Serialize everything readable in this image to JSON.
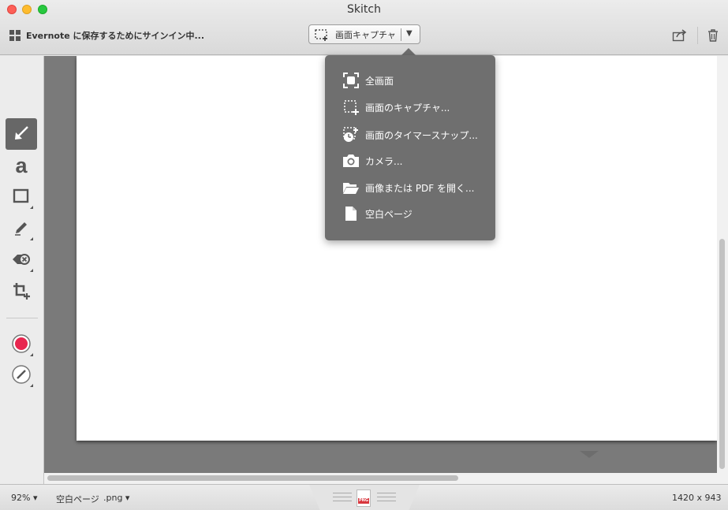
{
  "window": {
    "title": "Skitch"
  },
  "toolbar": {
    "signin_text": "Evernote に保存するためにサインイン中...",
    "capture_label": "画面キャプチャ"
  },
  "menu": {
    "items": [
      {
        "label": "全画面",
        "icon": "fullscreen-icon"
      },
      {
        "label": "画面のキャプチャ...",
        "icon": "crosshair-capture-icon"
      },
      {
        "label": "画面のタイマースナップ...",
        "icon": "timer-snap-icon"
      },
      {
        "label": "カメラ...",
        "icon": "camera-icon"
      },
      {
        "label": "画像または PDF を開く...",
        "icon": "folder-open-icon"
      },
      {
        "label": "空白ページ",
        "icon": "blank-page-icon"
      }
    ]
  },
  "tools": [
    {
      "name": "arrow-tool",
      "icon": "arrow-icon",
      "active": true
    },
    {
      "name": "text-tool",
      "icon": "text-a-icon",
      "glyph": "a"
    },
    {
      "name": "shape-tool",
      "icon": "rectangle-icon"
    },
    {
      "name": "pen-tool",
      "icon": "pencil-icon"
    },
    {
      "name": "stamp-tool",
      "icon": "stamp-icon"
    },
    {
      "name": "crop-tool",
      "icon": "crop-icon"
    },
    {
      "name": "color-picker",
      "icon": "color-dot-icon",
      "color": "#e8264f"
    },
    {
      "name": "line-width-picker",
      "icon": "line-width-icon"
    }
  ],
  "status": {
    "zoom": "92%",
    "page_name": "空白ページ",
    "format": ".png",
    "format_badge": "PNG",
    "dimensions": "1420 x 943"
  },
  "colors": {
    "accent": "#e8264f",
    "menu_bg": "#6f6f6f",
    "canvas_bg": "#7a7a7a"
  }
}
